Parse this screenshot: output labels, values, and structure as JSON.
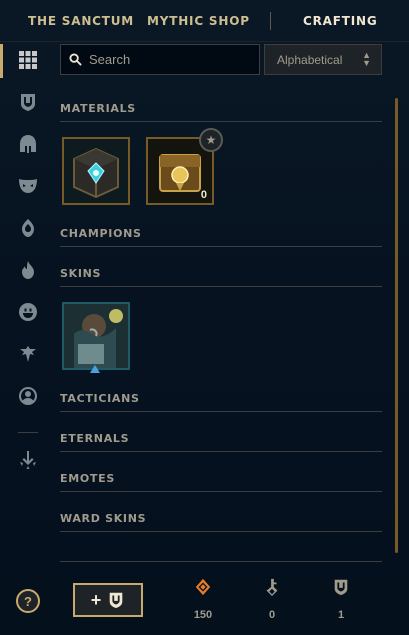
{
  "nav": {
    "tabs": [
      {
        "label": "THE SANCTUM",
        "active": false
      },
      {
        "label": "MYTHIC SHOP",
        "active": false
      },
      {
        "label": "CRAFTING",
        "active": true
      }
    ]
  },
  "sidebar": {
    "items": [
      {
        "icon": "grid-icon",
        "active": true
      },
      {
        "icon": "chest-shield-icon"
      },
      {
        "icon": "champion-helmet-icon"
      },
      {
        "icon": "skin-mask-icon"
      },
      {
        "icon": "ward-icon"
      },
      {
        "icon": "flame-icon"
      },
      {
        "icon": "emote-face-icon"
      },
      {
        "icon": "summoner-icon"
      },
      {
        "icon": "profile-icon"
      },
      {
        "icon": "disenchant-icon"
      }
    ]
  },
  "search": {
    "placeholder": "Search",
    "value": ""
  },
  "sort": {
    "selected": "Alphabetical",
    "options": [
      "Alphabetical"
    ]
  },
  "sections": {
    "materials": "MATERIALS",
    "champions": "CHAMPIONS",
    "skins": "SKINS",
    "tacticians": "TACTICIANS",
    "eternals": "ETERNALS",
    "emotes": "EMOTES",
    "ward_skins": "WARD SKINS"
  },
  "materials": [
    {
      "name": "hextech-chest",
      "count": ""
    },
    {
      "name": "masterwork-chest",
      "count": "0",
      "badge": "★"
    }
  ],
  "skins": [
    {
      "name": "skin-shard",
      "rarity_color": "#4aa3df"
    }
  ],
  "footer": {
    "help_label": "?",
    "add_label": "+",
    "currencies": [
      {
        "icon": "orange-essence-icon",
        "value": "150",
        "color": "#e77b2a"
      },
      {
        "icon": "key-fragment-icon",
        "value": "0",
        "color": "#a09b8c"
      },
      {
        "icon": "chest-icon",
        "value": "1",
        "color": "#a09b8c"
      }
    ]
  },
  "colors": {
    "gold": "#c8aa6e",
    "gold_dark": "#785a28",
    "text": "#a09b8c",
    "bg": "#010a13"
  }
}
